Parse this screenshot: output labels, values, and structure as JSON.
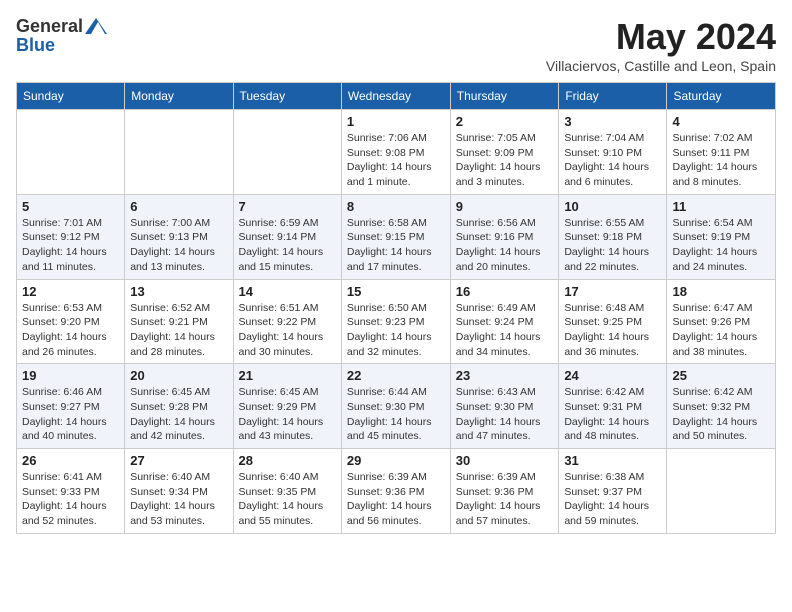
{
  "header": {
    "logo_line1": "General",
    "logo_line2": "Blue",
    "month": "May 2024",
    "location": "Villaciervos, Castille and Leon, Spain"
  },
  "weekdays": [
    "Sunday",
    "Monday",
    "Tuesday",
    "Wednesday",
    "Thursday",
    "Friday",
    "Saturday"
  ],
  "weeks": [
    [
      {
        "day": "",
        "sunrise": "",
        "sunset": "",
        "daylight": ""
      },
      {
        "day": "",
        "sunrise": "",
        "sunset": "",
        "daylight": ""
      },
      {
        "day": "",
        "sunrise": "",
        "sunset": "",
        "daylight": ""
      },
      {
        "day": "1",
        "sunrise": "Sunrise: 7:06 AM",
        "sunset": "Sunset: 9:08 PM",
        "daylight": "Daylight: 14 hours and 1 minute."
      },
      {
        "day": "2",
        "sunrise": "Sunrise: 7:05 AM",
        "sunset": "Sunset: 9:09 PM",
        "daylight": "Daylight: 14 hours and 3 minutes."
      },
      {
        "day": "3",
        "sunrise": "Sunrise: 7:04 AM",
        "sunset": "Sunset: 9:10 PM",
        "daylight": "Daylight: 14 hours and 6 minutes."
      },
      {
        "day": "4",
        "sunrise": "Sunrise: 7:02 AM",
        "sunset": "Sunset: 9:11 PM",
        "daylight": "Daylight: 14 hours and 8 minutes."
      }
    ],
    [
      {
        "day": "5",
        "sunrise": "Sunrise: 7:01 AM",
        "sunset": "Sunset: 9:12 PM",
        "daylight": "Daylight: 14 hours and 11 minutes."
      },
      {
        "day": "6",
        "sunrise": "Sunrise: 7:00 AM",
        "sunset": "Sunset: 9:13 PM",
        "daylight": "Daylight: 14 hours and 13 minutes."
      },
      {
        "day": "7",
        "sunrise": "Sunrise: 6:59 AM",
        "sunset": "Sunset: 9:14 PM",
        "daylight": "Daylight: 14 hours and 15 minutes."
      },
      {
        "day": "8",
        "sunrise": "Sunrise: 6:58 AM",
        "sunset": "Sunset: 9:15 PM",
        "daylight": "Daylight: 14 hours and 17 minutes."
      },
      {
        "day": "9",
        "sunrise": "Sunrise: 6:56 AM",
        "sunset": "Sunset: 9:16 PM",
        "daylight": "Daylight: 14 hours and 20 minutes."
      },
      {
        "day": "10",
        "sunrise": "Sunrise: 6:55 AM",
        "sunset": "Sunset: 9:18 PM",
        "daylight": "Daylight: 14 hours and 22 minutes."
      },
      {
        "day": "11",
        "sunrise": "Sunrise: 6:54 AM",
        "sunset": "Sunset: 9:19 PM",
        "daylight": "Daylight: 14 hours and 24 minutes."
      }
    ],
    [
      {
        "day": "12",
        "sunrise": "Sunrise: 6:53 AM",
        "sunset": "Sunset: 9:20 PM",
        "daylight": "Daylight: 14 hours and 26 minutes."
      },
      {
        "day": "13",
        "sunrise": "Sunrise: 6:52 AM",
        "sunset": "Sunset: 9:21 PM",
        "daylight": "Daylight: 14 hours and 28 minutes."
      },
      {
        "day": "14",
        "sunrise": "Sunrise: 6:51 AM",
        "sunset": "Sunset: 9:22 PM",
        "daylight": "Daylight: 14 hours and 30 minutes."
      },
      {
        "day": "15",
        "sunrise": "Sunrise: 6:50 AM",
        "sunset": "Sunset: 9:23 PM",
        "daylight": "Daylight: 14 hours and 32 minutes."
      },
      {
        "day": "16",
        "sunrise": "Sunrise: 6:49 AM",
        "sunset": "Sunset: 9:24 PM",
        "daylight": "Daylight: 14 hours and 34 minutes."
      },
      {
        "day": "17",
        "sunrise": "Sunrise: 6:48 AM",
        "sunset": "Sunset: 9:25 PM",
        "daylight": "Daylight: 14 hours and 36 minutes."
      },
      {
        "day": "18",
        "sunrise": "Sunrise: 6:47 AM",
        "sunset": "Sunset: 9:26 PM",
        "daylight": "Daylight: 14 hours and 38 minutes."
      }
    ],
    [
      {
        "day": "19",
        "sunrise": "Sunrise: 6:46 AM",
        "sunset": "Sunset: 9:27 PM",
        "daylight": "Daylight: 14 hours and 40 minutes."
      },
      {
        "day": "20",
        "sunrise": "Sunrise: 6:45 AM",
        "sunset": "Sunset: 9:28 PM",
        "daylight": "Daylight: 14 hours and 42 minutes."
      },
      {
        "day": "21",
        "sunrise": "Sunrise: 6:45 AM",
        "sunset": "Sunset: 9:29 PM",
        "daylight": "Daylight: 14 hours and 43 minutes."
      },
      {
        "day": "22",
        "sunrise": "Sunrise: 6:44 AM",
        "sunset": "Sunset: 9:30 PM",
        "daylight": "Daylight: 14 hours and 45 minutes."
      },
      {
        "day": "23",
        "sunrise": "Sunrise: 6:43 AM",
        "sunset": "Sunset: 9:30 PM",
        "daylight": "Daylight: 14 hours and 47 minutes."
      },
      {
        "day": "24",
        "sunrise": "Sunrise: 6:42 AM",
        "sunset": "Sunset: 9:31 PM",
        "daylight": "Daylight: 14 hours and 48 minutes."
      },
      {
        "day": "25",
        "sunrise": "Sunrise: 6:42 AM",
        "sunset": "Sunset: 9:32 PM",
        "daylight": "Daylight: 14 hours and 50 minutes."
      }
    ],
    [
      {
        "day": "26",
        "sunrise": "Sunrise: 6:41 AM",
        "sunset": "Sunset: 9:33 PM",
        "daylight": "Daylight: 14 hours and 52 minutes."
      },
      {
        "day": "27",
        "sunrise": "Sunrise: 6:40 AM",
        "sunset": "Sunset: 9:34 PM",
        "daylight": "Daylight: 14 hours and 53 minutes."
      },
      {
        "day": "28",
        "sunrise": "Sunrise: 6:40 AM",
        "sunset": "Sunset: 9:35 PM",
        "daylight": "Daylight: 14 hours and 55 minutes."
      },
      {
        "day": "29",
        "sunrise": "Sunrise: 6:39 AM",
        "sunset": "Sunset: 9:36 PM",
        "daylight": "Daylight: 14 hours and 56 minutes."
      },
      {
        "day": "30",
        "sunrise": "Sunrise: 6:39 AM",
        "sunset": "Sunset: 9:36 PM",
        "daylight": "Daylight: 14 hours and 57 minutes."
      },
      {
        "day": "31",
        "sunrise": "Sunrise: 6:38 AM",
        "sunset": "Sunset: 9:37 PM",
        "daylight": "Daylight: 14 hours and 59 minutes."
      },
      {
        "day": "",
        "sunrise": "",
        "sunset": "",
        "daylight": ""
      }
    ]
  ]
}
